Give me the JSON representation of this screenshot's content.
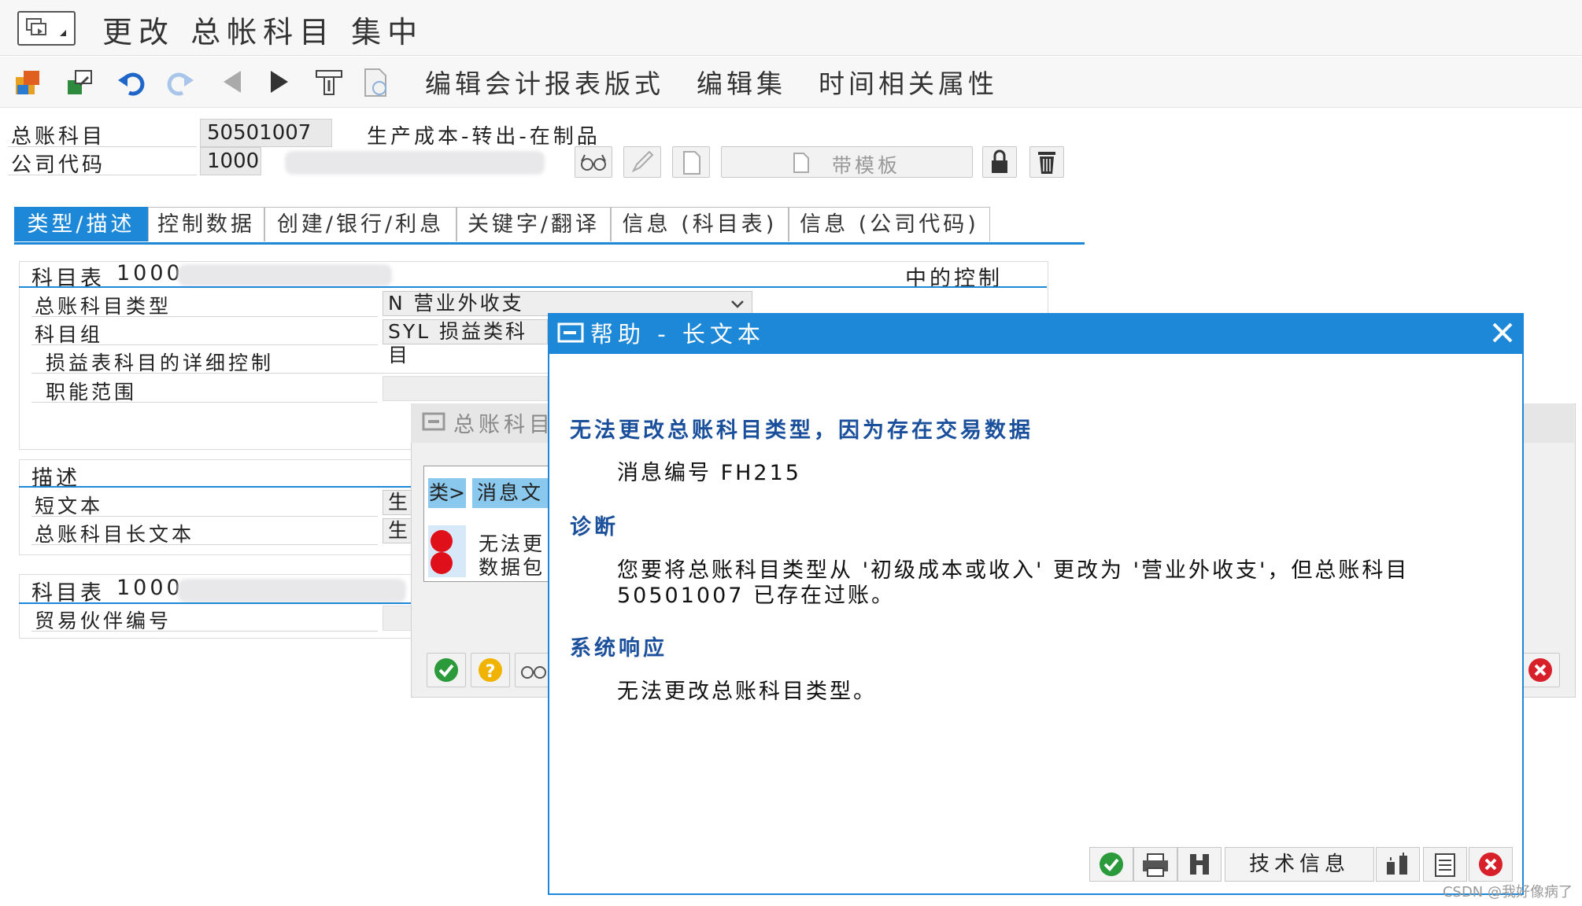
{
  "title_bar": {
    "title": "更改 总帐科目 集中"
  },
  "toolbar": {
    "links": [
      "编辑会计报表版式",
      "编辑集",
      "时间相关属性"
    ]
  },
  "header": {
    "gl_account_label": "总账科目",
    "gl_account_value": "50501007",
    "gl_account_desc": "生产成本-转出-在制品",
    "company_code_label": "公司代码",
    "company_code_value": "1000",
    "template_button_label": "带模板"
  },
  "tabs": [
    {
      "label": "类型/描述",
      "active": true
    },
    {
      "label": "控制数据",
      "active": false
    },
    {
      "label": "创建/银行/利息",
      "active": false
    },
    {
      "label": "关键字/翻译",
      "active": false
    },
    {
      "label": "信息 (科目表)",
      "active": false
    },
    {
      "label": "信息 (公司代码)",
      "active": false
    }
  ],
  "control_section": {
    "title_prefix": "科目表",
    "title_value": "1000",
    "title_suffix": "中的控制",
    "account_type_label": "总账科目类型",
    "account_type_value": "N 营业外收支",
    "account_group_label": "科目组",
    "account_group_value": "SYL 损益类科目",
    "pl_detail_label": "损益表科目的详细控制",
    "functional_area_label": "职能范围"
  },
  "description_section": {
    "title": "描述",
    "short_text_label": "短文本",
    "short_text_value": "生",
    "long_text_label": "总账科目长文本",
    "long_text_value": "生"
  },
  "partner_section": {
    "title_prefix": "科目表",
    "title_value": "1000",
    "partner_label": "贸易伙伴编号"
  },
  "bg_dialog": {
    "title": "总账科目",
    "col_type": "类>",
    "col_message": "消息文",
    "row_text_1": "无法更",
    "row_text_2": "数据包"
  },
  "help_dialog": {
    "title": "帮助 - 长文本",
    "headline": "无法更改总账科目类型，因为存在交易数据",
    "message_no": "消息编号 FH215",
    "diagnosis_heading": "诊断",
    "diagnosis_line1": "您要将总账科目类型从 '初级成本或收入' 更改为 '营业外收支'，但总账科目",
    "diagnosis_line2": "50501007 已存在过账。",
    "response_heading": "系统响应",
    "response_text": "无法更改总账科目类型。",
    "tech_info_button": "技术信息"
  },
  "watermark": "CSDN @我好像病了",
  "colors": {
    "accent": "#1e88d8",
    "help_heading": "#1a4f9c",
    "ok_green": "#2a9a3a",
    "cancel_red": "#d8202a",
    "error_red": "#e0101a",
    "help_yellow": "#f0b400"
  }
}
